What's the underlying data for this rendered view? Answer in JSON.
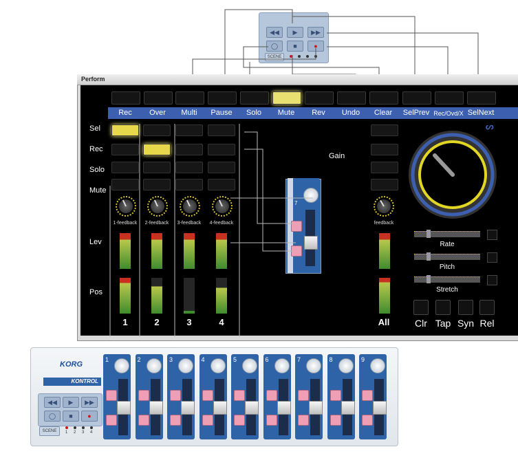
{
  "window": {
    "title": "Perform"
  },
  "top_buttons": [
    "Rec",
    "Over",
    "Multi",
    "Pause",
    "Solo",
    "Mute",
    "Rev",
    "Undo",
    "Clear",
    "SelPrev",
    "Rec/Ovd/X",
    "SelNext"
  ],
  "top_buttons_lit": [
    false,
    false,
    false,
    false,
    false,
    true,
    false,
    false,
    false,
    false,
    false,
    false
  ],
  "row_labels": [
    "Sel",
    "Rec",
    "Solo",
    "Mute",
    "Lev",
    "Pos"
  ],
  "channels": [
    {
      "number": "1",
      "knob_label": "1-feedback",
      "sel_lit": true,
      "rec_lit": false
    },
    {
      "number": "2",
      "knob_label": "2-feedback",
      "sel_lit": false,
      "rec_lit": true
    },
    {
      "number": "3",
      "knob_label": "3-feedback",
      "sel_lit": false,
      "rec_lit": false
    },
    {
      "number": "4",
      "knob_label": "4-feedback",
      "sel_lit": false,
      "rec_lit": false
    }
  ],
  "all_channel": {
    "number": "All",
    "knob_label": "feedback"
  },
  "gain_label": "Gain",
  "sliders": [
    "Rate",
    "Pitch",
    "Stretch"
  ],
  "bottom_right_buttons": [
    "Clr",
    "Tap",
    "Syn",
    "Rel"
  ],
  "korg": {
    "brand": "KORG",
    "product": "KONTROL",
    "scene_label": "SCENE",
    "scene_numbers": [
      "1",
      "2",
      "3",
      "4"
    ],
    "channel_numbers": [
      "1",
      "2",
      "3",
      "4",
      "5",
      "6",
      "7",
      "8",
      "9"
    ]
  },
  "gain_module_number": "7",
  "colors": {
    "accent_blue": "#3d5fb0",
    "led_yellow": "#e6d84a",
    "korg_blue": "#2f63a7"
  }
}
